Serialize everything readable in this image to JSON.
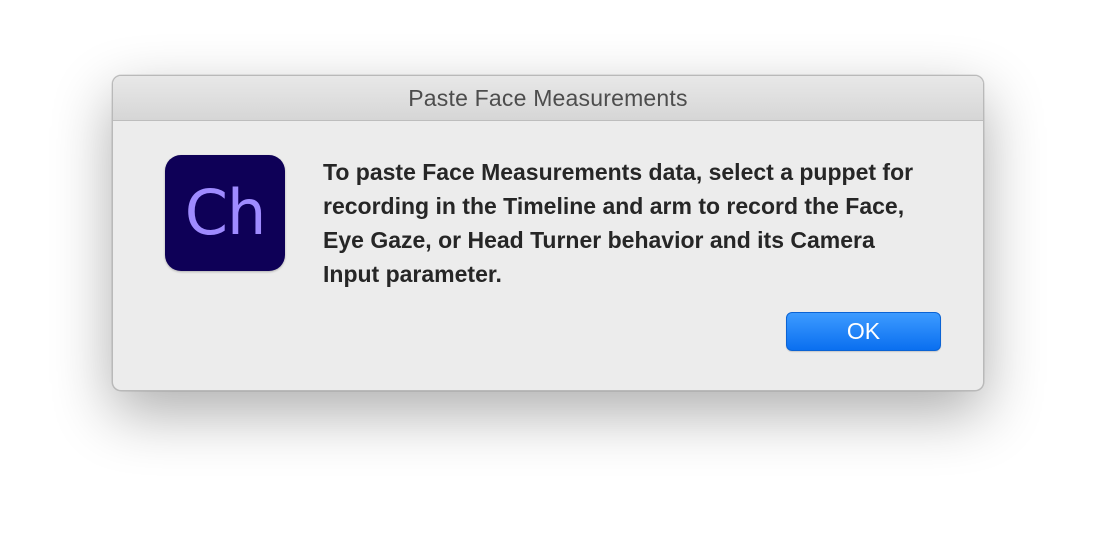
{
  "dialog": {
    "title": "Paste Face Measurements",
    "app_icon": {
      "name": "character-animator-icon",
      "label": "Ch",
      "background_color": "#0e0057",
      "text_color": "#9f8bff"
    },
    "message": "To paste Face Measurements data, select a puppet for recording in the Timeline and arm to record the Face, Eye Gaze, or Head Turner behavior and its Camera Input parameter.",
    "buttons": {
      "ok_label": "OK",
      "ok_color": "#1a7ff5"
    }
  }
}
